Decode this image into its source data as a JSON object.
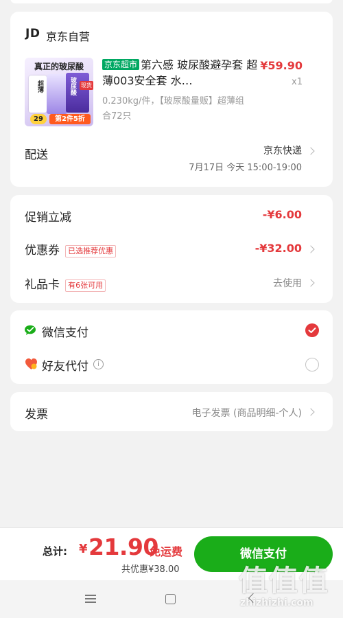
{
  "store": {
    "logo": "JD",
    "name": "京东自营"
  },
  "product": {
    "image_top_text": "真正的玻尿酸",
    "image_side_text": "玻尿酸",
    "image_left_text": "超薄",
    "image_corner_text": "现货",
    "image_price_text": "29",
    "image_promo_text": "第2件5折",
    "channel_tag": "京东超市",
    "title": "第六感 玻尿酸避孕套 超薄003安全套 水…",
    "price": "¥59.90",
    "quantity": "x1",
    "spec": "0.230kg/件，【玻尿酸量贩】超薄组合72只"
  },
  "delivery": {
    "label": "配送",
    "carrier": "京东快递",
    "time": "7月17日 今天 15:00-19:00"
  },
  "discounts": {
    "promo_label": "促销立减",
    "promo_value": "-¥6.00",
    "coupon_label": "优惠券",
    "coupon_tag": "已选推荐优惠",
    "coupon_value": "-¥32.00",
    "giftcard_label": "礼品卡",
    "giftcard_tag": "有6张可用",
    "giftcard_action": "去使用"
  },
  "payment": {
    "wechat_label": "微信支付",
    "friend_label": "好友代付"
  },
  "invoice": {
    "label": "发票",
    "value": "电子发票 (商品明细-个人)"
  },
  "footer": {
    "total_label": "总计:",
    "currency": "¥",
    "total_amount": "21.90",
    "shipping_text": "免运费",
    "saved_text": "共优惠¥38.00",
    "pay_button": "微信支付"
  },
  "watermark": {
    "text": "值值值",
    "site": "zhizhizhi.com"
  },
  "colors": {
    "accent_red": "#e4393c",
    "wechat_green": "#1aad19",
    "channel_tag_green": "#00a862"
  }
}
